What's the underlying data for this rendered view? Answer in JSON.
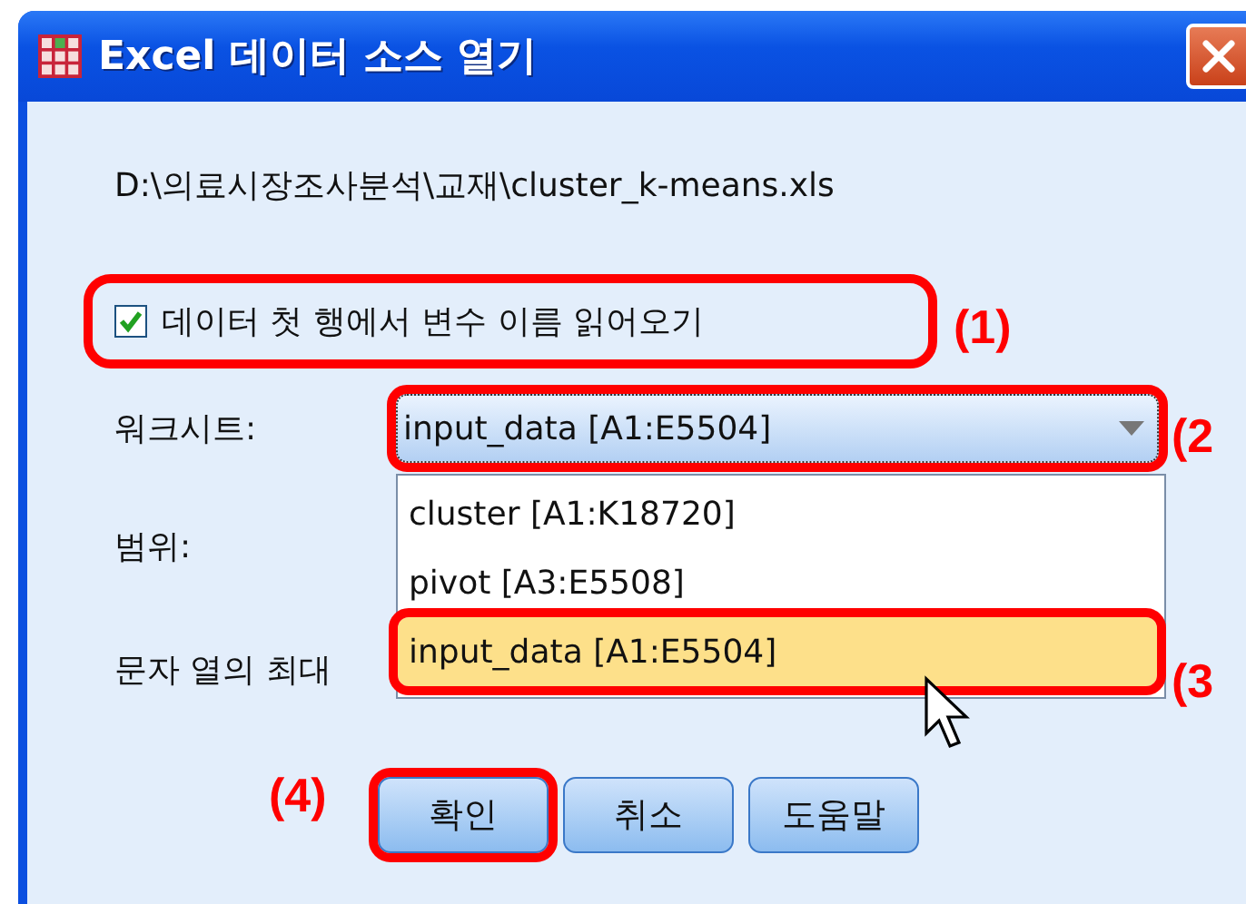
{
  "window": {
    "title": "Excel 데이터 소스 열기"
  },
  "file_path": "D:\\의료시장조사분석\\교재\\cluster_k-means.xls",
  "header_checkbox": {
    "label": "데이터 첫 행에서 변수 이름 읽어오기",
    "checked": true
  },
  "worksheet": {
    "label": "워크시트:",
    "value": "input_data [A1:E5504]",
    "expanded": true,
    "options": [
      {
        "label": "cluster [A1:K18720]",
        "selected": false
      },
      {
        "label": "pivot [A3:E5508]",
        "selected": false
      },
      {
        "label": "input_data [A1:E5504]",
        "selected": true
      }
    ]
  },
  "range": {
    "label": "범위:"
  },
  "max_string_width": {
    "label": "문자 열의 최대"
  },
  "buttons": [
    {
      "label": "확인"
    },
    {
      "label": "취소"
    },
    {
      "label": "도움말"
    }
  ],
  "annotations": [
    {
      "label": "(1)"
    },
    {
      "label": "(2"
    },
    {
      "label": "(3"
    },
    {
      "label": "(4)"
    }
  ]
}
